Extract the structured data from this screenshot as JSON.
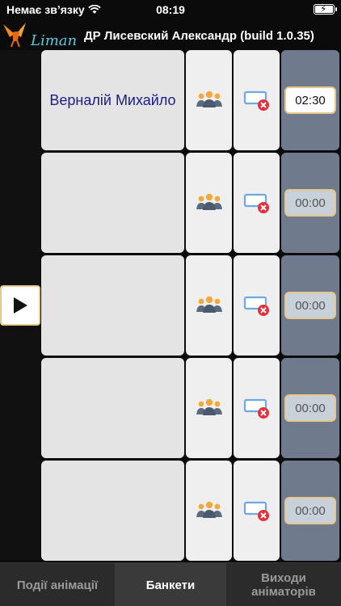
{
  "status_bar": {
    "carrier": "Немає звʼязку",
    "time": "08:19"
  },
  "header": {
    "logo_text": "Liman",
    "title": "ДР Лисевский Александр (build 1.0.35)"
  },
  "rows": [
    {
      "name": "Верналій Михайло",
      "time": "02:30",
      "active": true
    },
    {
      "name": "",
      "time": "00:00",
      "active": false
    },
    {
      "name": "",
      "time": "00:00",
      "active": false
    },
    {
      "name": "",
      "time": "00:00",
      "active": false
    },
    {
      "name": "",
      "time": "00:00",
      "active": false
    }
  ],
  "tabs": {
    "events": "Події анімації",
    "banquets": "Банкети",
    "exits": "Виходи аніматорів"
  },
  "colors": {
    "accent_border": "#e7c889",
    "time_column": "#6f7b8d",
    "name_text": "#1c1c8a"
  },
  "icons": {
    "guests": "people-group-icon",
    "close": "window-close-icon",
    "play": "play-icon"
  }
}
